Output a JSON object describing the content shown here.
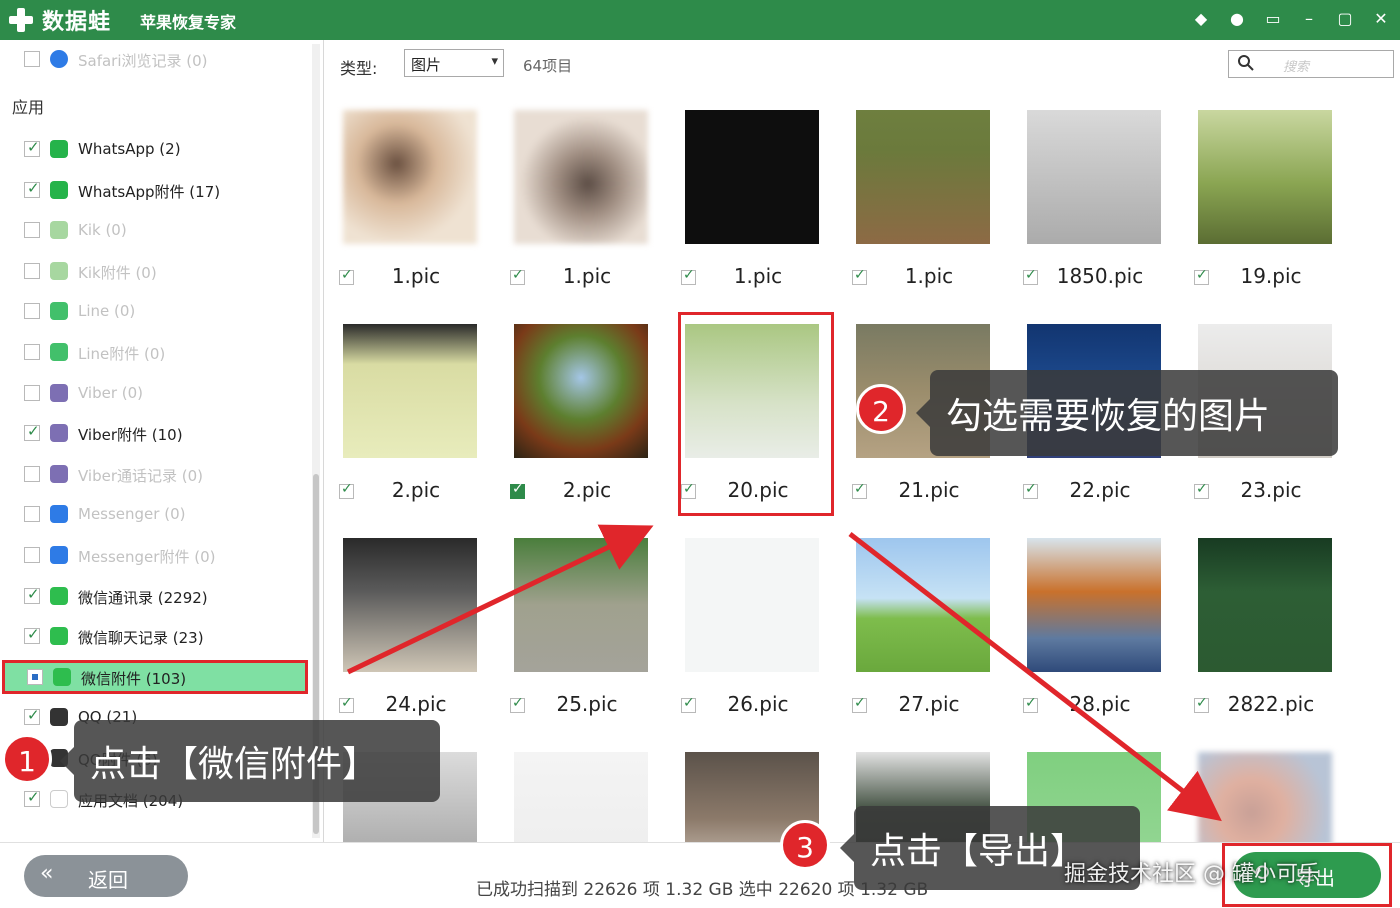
{
  "titlebar": {
    "logo_text": "数据蛙",
    "app_title": "苹果恢复专家",
    "icons": [
      "diamond-icon",
      "chat-bubble-icon",
      "monitor-icon",
      "minimize-icon",
      "maximize-icon",
      "close-icon"
    ],
    "icon_glyphs": [
      "◆",
      "●",
      "▭",
      "–",
      "▢",
      "✕"
    ]
  },
  "sidebar": {
    "top_item": "Safari浏览记录 (0)",
    "section_label": "应用",
    "items": [
      {
        "label": "WhatsApp (2)",
        "checked": true,
        "dim": false,
        "icon_color": "#25b34a"
      },
      {
        "label": "WhatsApp附件 (17)",
        "checked": true,
        "dim": false,
        "icon_color": "#25b34a"
      },
      {
        "label": "Kik (0)",
        "checked": false,
        "dim": true,
        "icon_color": "#a7d7a0"
      },
      {
        "label": "Kik附件 (0)",
        "checked": false,
        "dim": true,
        "icon_color": "#a7d7a0"
      },
      {
        "label": "Line (0)",
        "checked": false,
        "dim": true,
        "icon_color": "#42c06b"
      },
      {
        "label": "Line附件 (0)",
        "checked": false,
        "dim": true,
        "icon_color": "#42c06b"
      },
      {
        "label": "Viber (0)",
        "checked": false,
        "dim": true,
        "icon_color": "#7d6fb3"
      },
      {
        "label": "Viber附件 (10)",
        "checked": true,
        "dim": false,
        "icon_color": "#7d6fb3"
      },
      {
        "label": "Viber通话记录 (0)",
        "checked": false,
        "dim": true,
        "icon_color": "#7d6fb3"
      },
      {
        "label": "Messenger (0)",
        "checked": false,
        "dim": true,
        "icon_color": "#2e7be6"
      },
      {
        "label": "Messenger附件 (0)",
        "checked": false,
        "dim": true,
        "icon_color": "#2e7be6"
      },
      {
        "label": "微信通讯录 (2292)",
        "checked": true,
        "dim": false,
        "icon_color": "#2ebd4e"
      },
      {
        "label": "微信聊天记录 (23)",
        "checked": true,
        "dim": false,
        "icon_color": "#2ebd4e"
      },
      {
        "label": "微信附件 (103)",
        "checked": "partial",
        "dim": false,
        "icon_color": "#2ebd4e",
        "selected": true
      },
      {
        "label": "QQ (21)",
        "checked": true,
        "dim": false,
        "icon_color": "#333333"
      },
      {
        "label": "QQ附件 (6)",
        "checked": false,
        "dim": false,
        "icon_color": "#333333"
      },
      {
        "label": "应用文档 (204)",
        "checked": true,
        "dim": false,
        "icon_color": "#ffffff"
      }
    ]
  },
  "toolbar": {
    "type_label": "类型:",
    "type_value": "图片",
    "count_text": "64项目",
    "search_placeholder": "搜索"
  },
  "grid": {
    "rows": [
      [
        {
          "name": "1.pic",
          "art": "blur1"
        },
        {
          "name": "1.pic",
          "art": "blur2"
        },
        {
          "name": "1.pic",
          "art": "dark"
        },
        {
          "name": "1.pic",
          "art": "dog"
        },
        {
          "name": "1850.pic",
          "art": "box"
        },
        {
          "name": "19.pic",
          "art": "bird"
        }
      ],
      [
        {
          "name": "2.pic",
          "art": "tea"
        },
        {
          "name": "2.pic",
          "art": "trees",
          "strong": true
        },
        {
          "name": "20.pic",
          "art": "corgi",
          "highlight": true
        },
        {
          "name": "21.pic",
          "art": "cat"
        },
        {
          "name": "22.pic",
          "art": "sea"
        },
        {
          "name": "23.pic",
          "art": "foxcat"
        }
      ],
      [
        {
          "name": "24.pic",
          "art": "cats2"
        },
        {
          "name": "25.pic",
          "art": "chick"
        },
        {
          "name": "26.pic",
          "art": "fish"
        },
        {
          "name": "27.pic",
          "art": "peppa"
        },
        {
          "name": "28.pic",
          "art": "lake"
        },
        {
          "name": "2822.pic",
          "art": "green-doc"
        }
      ],
      [
        {
          "name": "",
          "art": "ledge"
        },
        {
          "name": "",
          "art": "doc"
        },
        {
          "name": "",
          "art": "hand"
        },
        {
          "name": "",
          "art": "forest"
        },
        {
          "name": "",
          "art": "greenchat"
        },
        {
          "name": "",
          "art": "blurface"
        }
      ]
    ]
  },
  "bottombar": {
    "back_label": "返回",
    "status_text": "已成功扫描到 22626 项 1.32 GB  选中 22620 项 1.32 GB",
    "export_label": "导出"
  },
  "annotations": {
    "step1_badge": "1",
    "step1_text": "点击【微信附件】",
    "step2_badge": "2",
    "step2_text": "勾选需要恢复的图片",
    "step3_badge": "3",
    "step3_text": "点击【导出】",
    "arrow_color": "#e0262b"
  },
  "watermark": "掘金技术社区 @ 罐小可乐"
}
